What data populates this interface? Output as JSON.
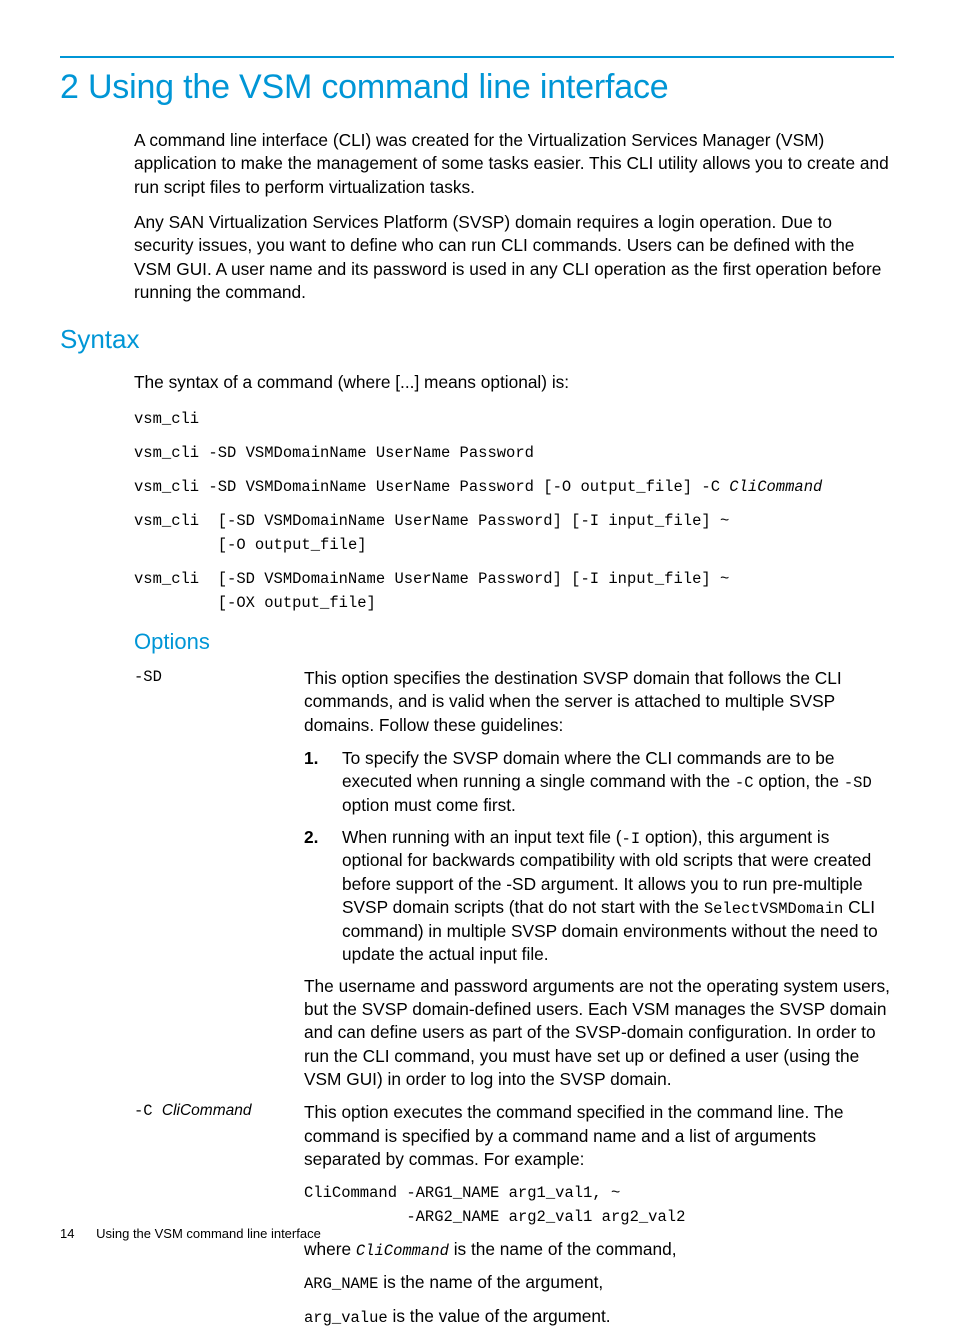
{
  "chapter_title": "2 Using the VSM command line interface",
  "intro_p1": "A command line interface (CLI) was created for the Virtualization Services Manager (VSM) application to make the management of some tasks easier. This CLI utility allows you to create and run script files to perform virtualization tasks.",
  "intro_p2": "Any SAN Virtualization Services Platform (SVSP) domain requires a login operation. Due to security issues, you want to define who can run CLI commands. Users can be defined with the VSM GUI. A user name and its password is used in any CLI operation as the first operation before running the command.",
  "syntax_heading": "Syntax",
  "syntax_intro": "The syntax of a command (where [...] means optional) is:",
  "syntax_code1": "vsm_cli",
  "syntax_code2": "vsm_cli -SD VSMDomainName UserName Password",
  "syntax_code3_pre": "vsm_cli -SD VSMDomainName UserName Password [-O output_file] -C ",
  "syntax_code3_ital": "CliCommand",
  "syntax_code4": "vsm_cli  [-SD VSMDomainName UserName Password] [-I input_file] ~\n         [-O output_file]",
  "syntax_code5": "vsm_cli  [-SD VSMDomainName UserName Password] [-I input_file] ~\n         [-OX output_file]",
  "options_heading": "Options",
  "opt_sd": {
    "label": "-SD",
    "p1": "This option specifies the destination SVSP domain that follows the CLI commands, and is valid when the server is attached to multiple SVSP domains. Follow these guidelines:",
    "li1_a": "To specify the SVSP domain where the CLI commands are to be executed when running a single command with the ",
    "li1_c1": "-C",
    "li1_b": " option, the ",
    "li1_c2": "-SD",
    "li1_c": " option must come first.",
    "li2_a": "When running with an input text file (",
    "li2_c1": "-I",
    "li2_b": " option), this argument is optional for backwards compatibility with old scripts that were created before support of the -SD argument. It allows you to run pre-multiple SVSP domain scripts (that do not start with the ",
    "li2_c2": "SelectVSMDomain",
    "li2_c": " CLI command) in multiple SVSP domain environments without the need to update the actual input file.",
    "p3": "The username and password arguments are not the operating system users, but the SVSP domain-defined users. Each VSM manages the SVSP domain and can define users as part of the SVSP-domain configuration. In order to run the CLI command, you must have set up or defined a user (using the VSM GUI) in order to log into the SVSP domain."
  },
  "opt_c": {
    "label_mono": "-C ",
    "label_ital": "CliCommand",
    "p1": "This option executes the command specified in the command line. The command is specified by a command name and a list of arguments separated by commas. For example:",
    "code": "CliCommand -ARG1_NAME arg1_val1, ~\n           -ARG2_NAME arg2_val1 arg2_val2",
    "p2a": "where ",
    "p2_code": "CliCommand",
    "p2b": " is the name of the command,",
    "p3_code": "ARG_NAME",
    "p3b": " is the name of the argument,",
    "p4_code": "arg_value",
    "p4b": " is the value of the argument."
  },
  "footer": {
    "page": "14",
    "title": "Using the VSM command line interface"
  }
}
